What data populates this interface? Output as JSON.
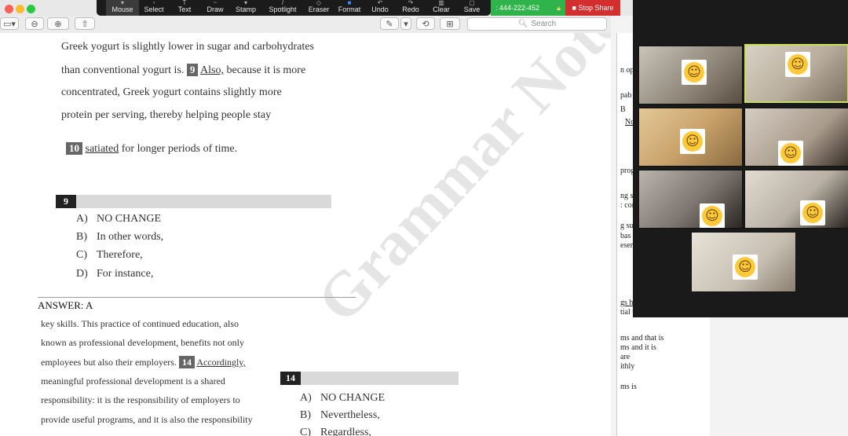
{
  "toolbar": {
    "search_placeholder": "Search",
    "icons": [
      "sidebar-icon",
      "zoom-out-icon",
      "zoom-in-icon",
      "share-icon",
      "pen-icon",
      "chevron-down-icon",
      "rotate-icon",
      "toolbox-icon"
    ]
  },
  "annotate_bar": {
    "items": [
      "Mouse",
      "Select",
      "Text",
      "Draw",
      "Stamp",
      "Spotlight",
      "Eraser",
      "Format",
      "Undo",
      "Redo",
      "Clear",
      "Save"
    ],
    "meeting_id": ": 444-222-452",
    "stop_share": "Stop Share"
  },
  "document": {
    "para1": {
      "line1": "Greek yogurt is slightly lower in sugar and carbohydrates",
      "line2a": "than conventional yogurt is.",
      "q9": "9",
      "also": "Also,",
      "line2b": "because it is more",
      "line3": "concentrated, Greek yogurt contains slightly more",
      "line4": "protein per serving, thereby helping people stay",
      "q10": "10",
      "satiated": "satiated",
      "line5b": "for longer periods of time."
    },
    "question9": {
      "number": "9",
      "options": [
        {
          "letter": "A)",
          "text": "NO CHANGE"
        },
        {
          "letter": "B)",
          "text": "In other words,"
        },
        {
          "letter": "C)",
          "text": "Therefore,"
        },
        {
          "letter": "D)",
          "text": "For instance,"
        }
      ]
    },
    "answer": "ANSWER: A",
    "para2": {
      "line1": "key skills. This practice of continued education, also",
      "line2": "known as professional development, benefits not only",
      "line3a": "employees but also their employers.",
      "q14": "14",
      "accordingly": "Accordingly,",
      "line4": "meaningful professional development is a shared",
      "line5": "responsibility: it is the responsibility of employers to",
      "line6": "provide useful programs, and it is also the responsibility"
    },
    "question14": {
      "number": "14",
      "options": [
        {
          "letter": "A)",
          "text": "NO CHANGE"
        },
        {
          "letter": "B)",
          "text": "Nevertheless,"
        },
        {
          "letter": "C)",
          "text": "Regardless,"
        }
      ]
    },
    "watermark": "Grammar Note"
  },
  "right_doc": {
    "lines": [
      "n op",
      "pab",
      "B",
      "No",
      "prog",
      "ng si",
      ": con",
      "g su",
      " bas",
      "eserv",
      "gs hi",
      "tial t",
      "ms and that is",
      "ms and it is",
      "are",
      "ithly",
      "ms is"
    ]
  }
}
